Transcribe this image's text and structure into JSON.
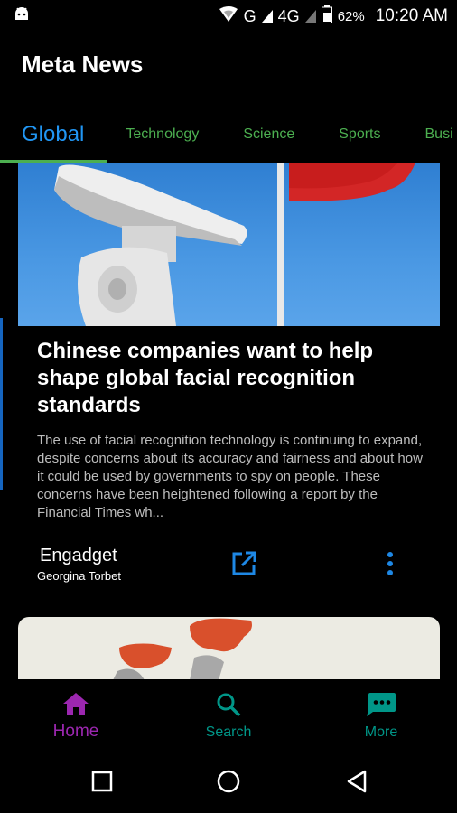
{
  "status_bar": {
    "network": "G",
    "network2": "4G",
    "battery": "62%",
    "time": "10:20 AM",
    "icons": [
      "android-icon",
      "wifi-icon",
      "signal-icon",
      "battery-icon"
    ]
  },
  "app": {
    "title": "Meta News"
  },
  "tabs": [
    {
      "label": "Global"
    },
    {
      "label": "Technology"
    },
    {
      "label": "Science"
    },
    {
      "label": "Sports"
    },
    {
      "label": "Busi"
    }
  ],
  "article": {
    "headline": "Chinese companies want to help shape global facial recognition standards",
    "summary": "The use of facial recognition technology is continuing to expand, despite concerns about its accuracy and fairness and about how it could be used by governments to spy on people. These concerns have been heightened following a report by the Financial Times wh...",
    "source": "Engadget",
    "author": "Georgina Torbet"
  },
  "bottom_nav": {
    "home": "Home",
    "search": "Search",
    "more": "More"
  },
  "colors": {
    "active_tab": "#2196f3",
    "tab": "#4caf50",
    "home": "#9c27b0",
    "teal": "#009688",
    "accent_blue": "#1e88e5"
  }
}
